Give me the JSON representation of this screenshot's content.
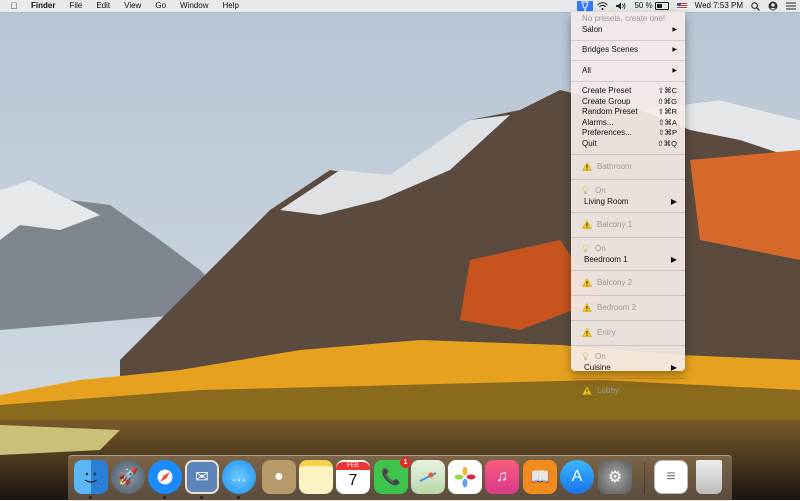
{
  "menubar": {
    "app": "Finder",
    "items": [
      "File",
      "Edit",
      "View",
      "Go",
      "Window",
      "Help"
    ],
    "battery": "50 %",
    "clock": "Wed 7:53 PM"
  },
  "menu": {
    "no_presets": "No presets, create one!",
    "salon": "Salon",
    "bridges": "Bridges Scenes",
    "all": "All",
    "actions": [
      {
        "label": "Create Preset",
        "shortcut": "⇧⌘C"
      },
      {
        "label": "Create Group",
        "shortcut": "⇧⌘G"
      },
      {
        "label": "Random Preset",
        "shortcut": "⇧⌘R"
      },
      {
        "label": "Alarms...",
        "shortcut": "⇧⌘A"
      },
      {
        "label": "Preferences...",
        "shortcut": "⇧⌘P"
      },
      {
        "label": "Quit",
        "shortcut": "⇧⌘Q"
      }
    ],
    "rooms": {
      "bathroom": "Bathroom",
      "on1": "On",
      "living_room": "Living Room",
      "balcony1": "Balcony 1",
      "on2": "On",
      "bedroom1": "Beedroom 1",
      "balcony2": "Balcony 2",
      "bedroom2": "Bedroom 2",
      "entry": "Entry",
      "on3": "On",
      "cuisine": "Cuisine",
      "lobby": "Lobby"
    }
  },
  "dock": {
    "ical_month": "FEB",
    "ical_day": "7",
    "facetime_badge": "1"
  },
  "colors": {
    "accent": "#3478f6",
    "warning": "#f5c518"
  }
}
